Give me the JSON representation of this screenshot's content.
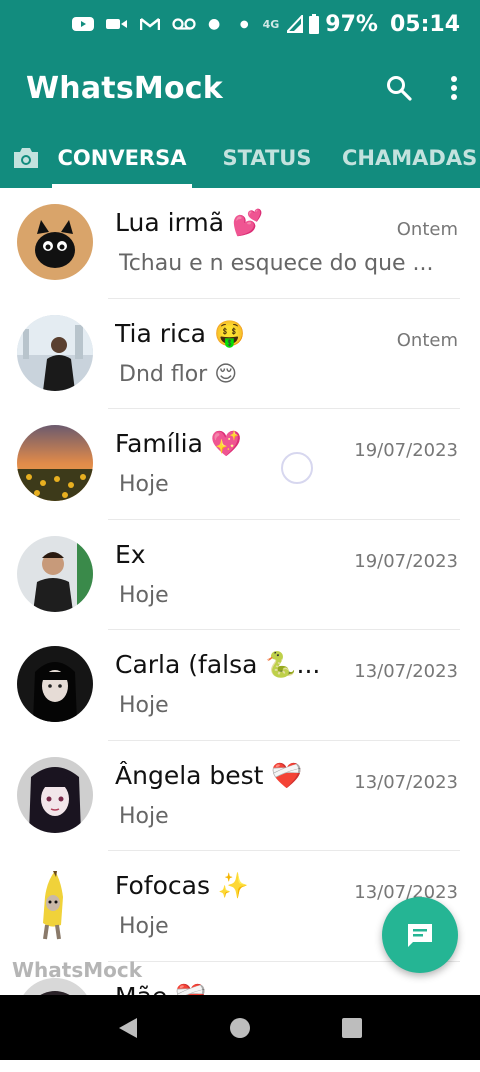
{
  "status_bar": {
    "network": "4G",
    "battery": "97%",
    "time": "05:14",
    "icons": [
      "youtube-icon",
      "video-icon",
      "gmail-icon",
      "voicemail-icon",
      "dot-icon"
    ]
  },
  "app": {
    "title": "WhatsMock",
    "accent": "#128C7E",
    "fab_color": "#25B594"
  },
  "tabs": [
    {
      "label": "CONVERSA",
      "active": true
    },
    {
      "label": "STATUS",
      "active": false
    },
    {
      "label": "CHAMADAS",
      "active": false
    }
  ],
  "chats": [
    {
      "name": "Lua irmã 💕",
      "time": "Ontem",
      "message": "Tchau e n esquece do que ..."
    },
    {
      "name": "Tia rica 🤑",
      "time": "Ontem",
      "message": "Dnd flor 😌"
    },
    {
      "name": "Família 💖",
      "time": "19/07/2023",
      "message": "Hoje"
    },
    {
      "name": "Ex",
      "time": "19/07/2023",
      "message": "Hoje"
    },
    {
      "name": "Carla (falsa 🐍...",
      "time": "13/07/2023",
      "message": "Hoje"
    },
    {
      "name": "Ângela best ❤️‍🩹",
      "time": "13/07/2023",
      "message": "Hoje"
    },
    {
      "name": "Fofocas ✨",
      "time": "13/07/2023",
      "message": "Hoje"
    },
    {
      "name": "Mãe ❤️‍🩹",
      "time": "",
      "message": ""
    }
  ],
  "watermark": "WhatsMock"
}
